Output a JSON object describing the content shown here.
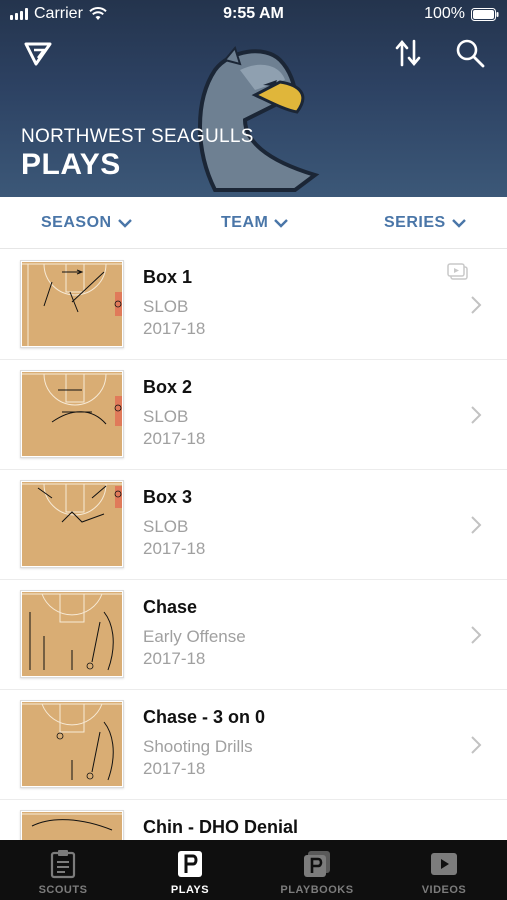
{
  "status_bar": {
    "carrier": "Carrier",
    "time": "9:55 AM",
    "battery": "100%"
  },
  "header": {
    "team_name": "NORTHWEST SEAGULLS",
    "title": "PLAYS"
  },
  "filters": [
    {
      "label": "SEASON"
    },
    {
      "label": "TEAM"
    },
    {
      "label": "SERIES"
    }
  ],
  "plays": [
    {
      "title": "Box 1",
      "category": "SLOB",
      "season": "2017-18",
      "has_video": true
    },
    {
      "title": "Box 2",
      "category": "SLOB",
      "season": "2017-18",
      "has_video": false
    },
    {
      "title": "Box 3",
      "category": "SLOB",
      "season": "2017-18",
      "has_video": false
    },
    {
      "title": "Chase",
      "category": "Early Offense",
      "season": "2017-18",
      "has_video": false
    },
    {
      "title": "Chase - 3 on 0",
      "category": "Shooting Drills",
      "season": "2017-18",
      "has_video": false
    },
    {
      "title": "Chin - DHO Denial",
      "category": "",
      "season": "",
      "has_video": false
    }
  ],
  "tabs": [
    {
      "label": "SCOUTS",
      "icon": "scouts-icon",
      "active": false
    },
    {
      "label": "PLAYS",
      "icon": "plays-icon",
      "active": true
    },
    {
      "label": "PLAYBOOKS",
      "icon": "playbooks-icon",
      "active": false
    },
    {
      "label": "VIDEOS",
      "icon": "videos-icon",
      "active": false
    }
  ],
  "colors": {
    "header_bg": "#2d4263",
    "accent": "#4a76a8",
    "tabbar_bg": "#0f0f0f",
    "court": "#d9ad74"
  }
}
